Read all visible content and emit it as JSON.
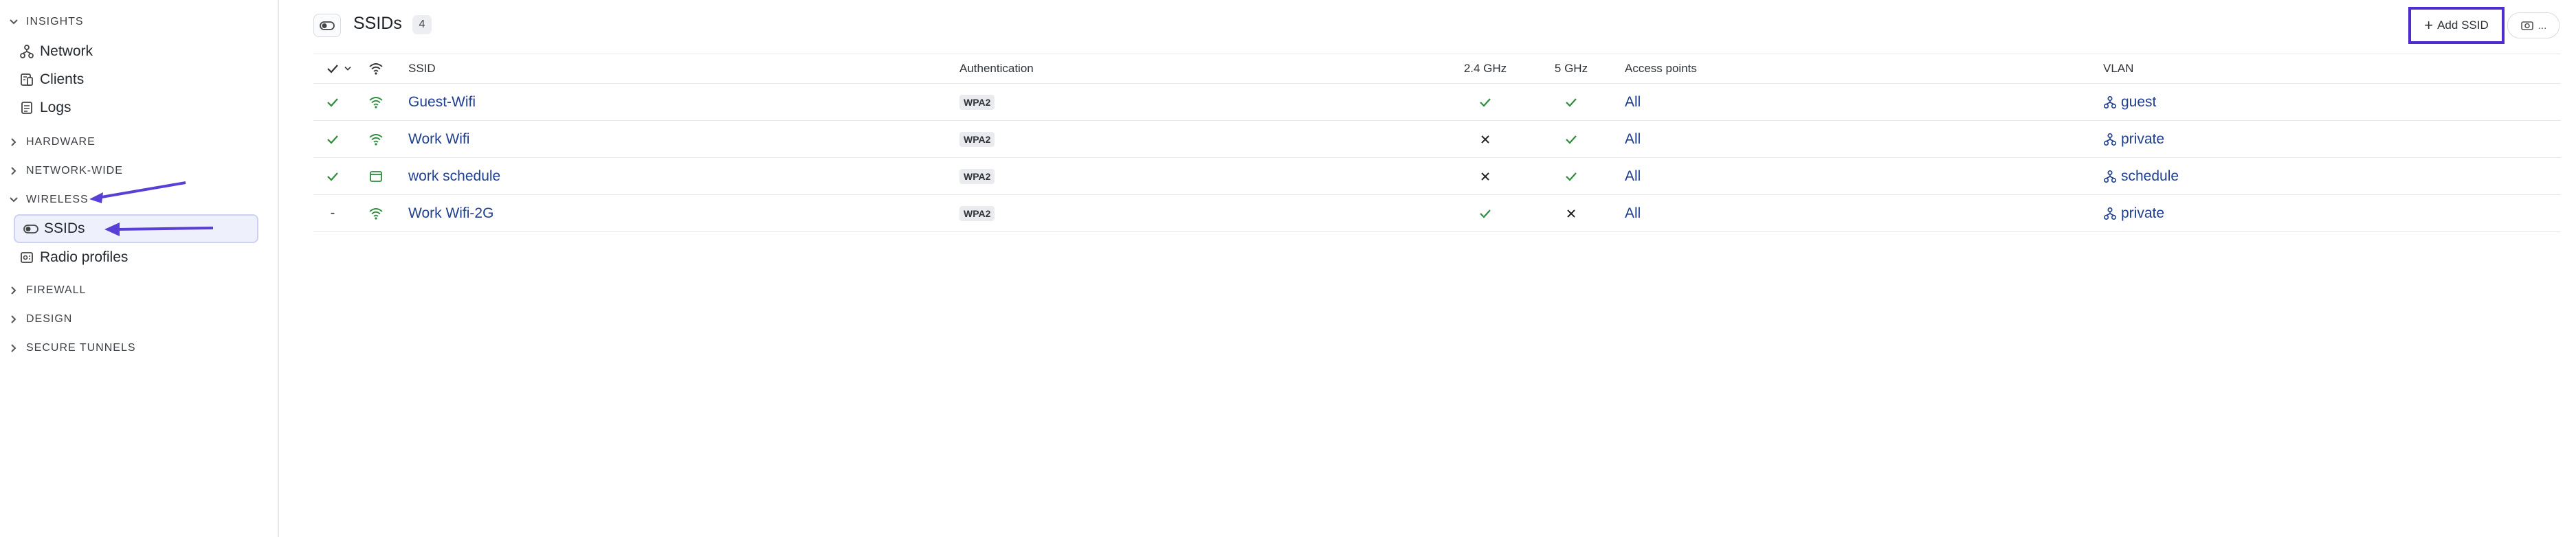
{
  "sidebar": {
    "sections": [
      {
        "label": "INSIGHTS",
        "expanded": true
      },
      {
        "label": "HARDWARE",
        "expanded": false
      },
      {
        "label": "NETWORK-WIDE",
        "expanded": false
      },
      {
        "label": "WIRELESS",
        "expanded": true
      },
      {
        "label": "FIREWALL",
        "expanded": false
      },
      {
        "label": "DESIGN",
        "expanded": false
      },
      {
        "label": "SECURE TUNNELS",
        "expanded": false
      }
    ],
    "insights_items": [
      {
        "label": "Network",
        "icon": "network-icon"
      },
      {
        "label": "Clients",
        "icon": "clients-icon"
      },
      {
        "label": "Logs",
        "icon": "logs-icon"
      }
    ],
    "wireless_items": [
      {
        "label": "SSIDs",
        "icon": "toggle-icon",
        "active": true
      },
      {
        "label": "Radio profiles",
        "icon": "radio-profile-icon",
        "active": false
      }
    ]
  },
  "header": {
    "title": "SSIDs",
    "count": "4",
    "add_button": "Add SSID",
    "more_button": "..."
  },
  "table": {
    "columns": [
      "SSID",
      "Authentication",
      "2.4 GHz",
      "5 GHz",
      "Access points",
      "VLAN"
    ],
    "rows": [
      {
        "enabled": "check",
        "type": "wifi",
        "ssid": "Guest-Wifi",
        "auth": "WPA2",
        "band24": "check",
        "band5": "check",
        "access_points": "All",
        "vlan": "guest"
      },
      {
        "enabled": "check",
        "type": "wifi",
        "ssid": "Work Wifi",
        "auth": "WPA2",
        "band24": "cross",
        "band5": "check",
        "access_points": "All",
        "vlan": "private"
      },
      {
        "enabled": "check",
        "type": "schedule",
        "ssid": "work schedule",
        "auth": "WPA2",
        "band24": "cross",
        "band5": "check",
        "access_points": "All",
        "vlan": "schedule"
      },
      {
        "enabled": "dash",
        "type": "wifi",
        "ssid": "Work Wifi-2G",
        "auth": "WPA2",
        "band24": "check",
        "band5": "cross",
        "access_points": "All",
        "vlan": "private"
      }
    ]
  },
  "colors": {
    "accent": "#4f2ccf",
    "link": "#1f3f8f",
    "check": "#2e8b3c",
    "active_bg": "#eef0fb"
  }
}
